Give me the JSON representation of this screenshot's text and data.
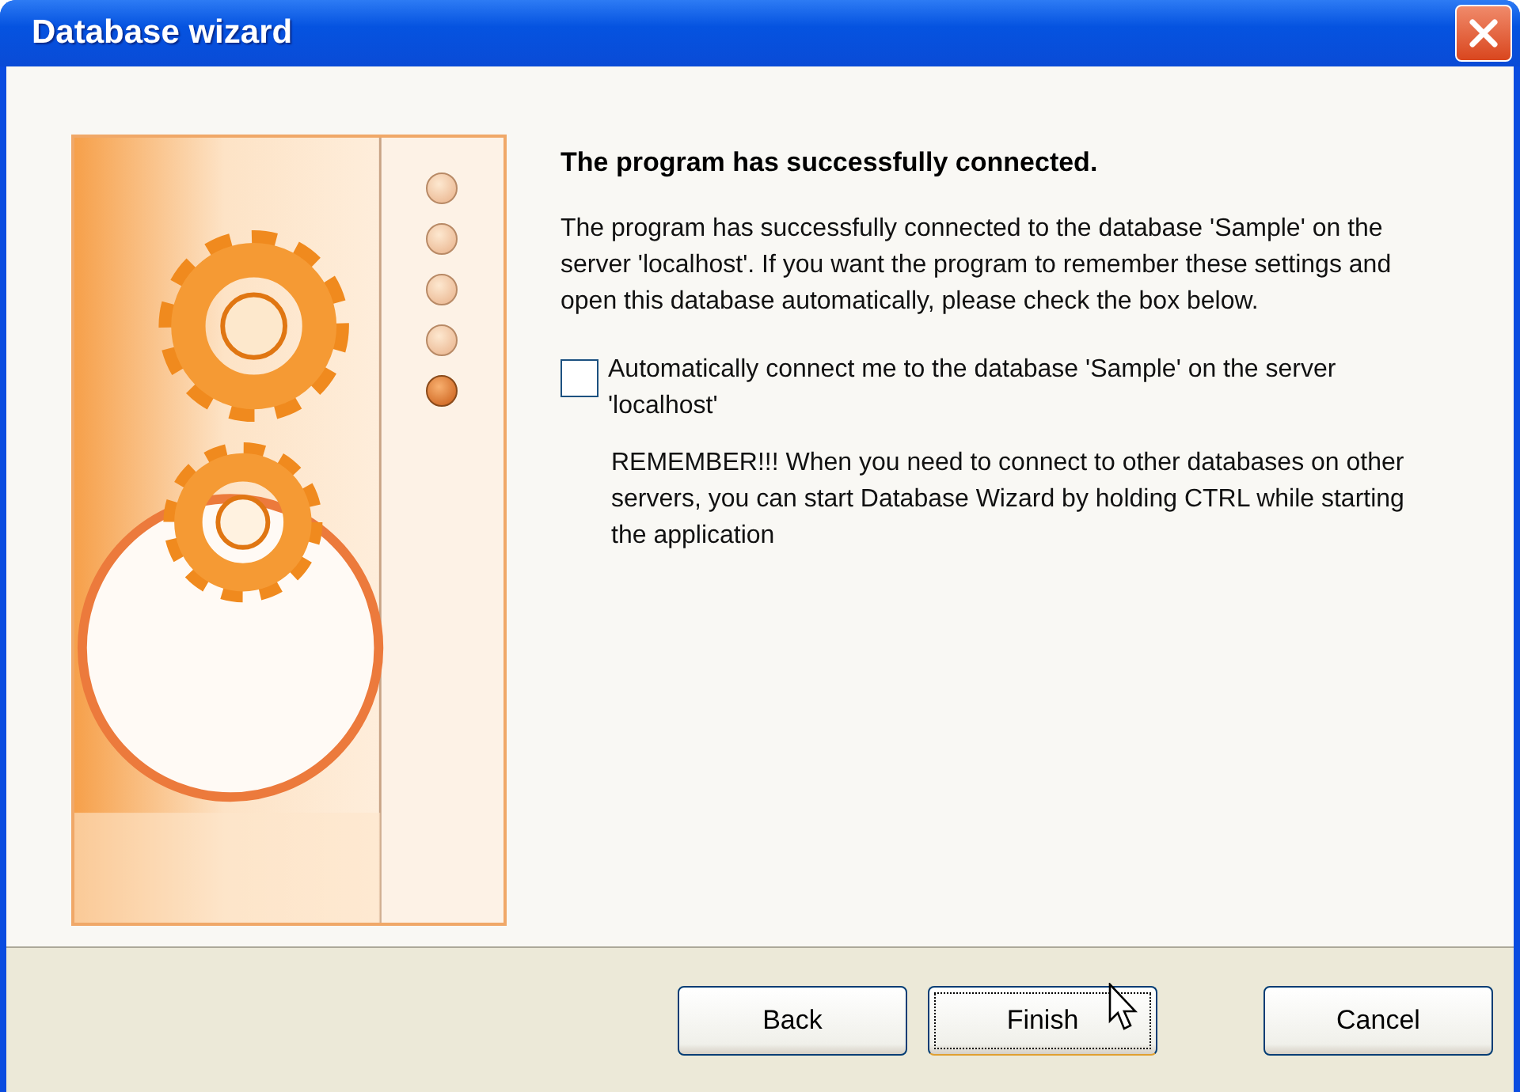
{
  "window": {
    "title": "Database wizard"
  },
  "steps": [
    {
      "selected": false
    },
    {
      "selected": false
    },
    {
      "selected": false
    },
    {
      "selected": false
    },
    {
      "selected": true
    }
  ],
  "heading": "The program has successfully connected.",
  "message": "The program has successfully connected to the database 'Sample' on the server 'localhost'. If you want the program to remember these settings and open this database automatically, please check the box below.",
  "auto_connect": {
    "label": "Automatically connect me to the database 'Sample' on the server 'localhost'",
    "checked": false
  },
  "note": "REMEMBER!!! When you need to connect to other databases on other servers, you can start Database Wizard by holding CTRL while starting the application",
  "buttons": [
    {
      "label": "Back",
      "focused": false
    },
    {
      "label": "Finish",
      "focused": true
    },
    {
      "label": "Cancel",
      "focused": false
    }
  ]
}
